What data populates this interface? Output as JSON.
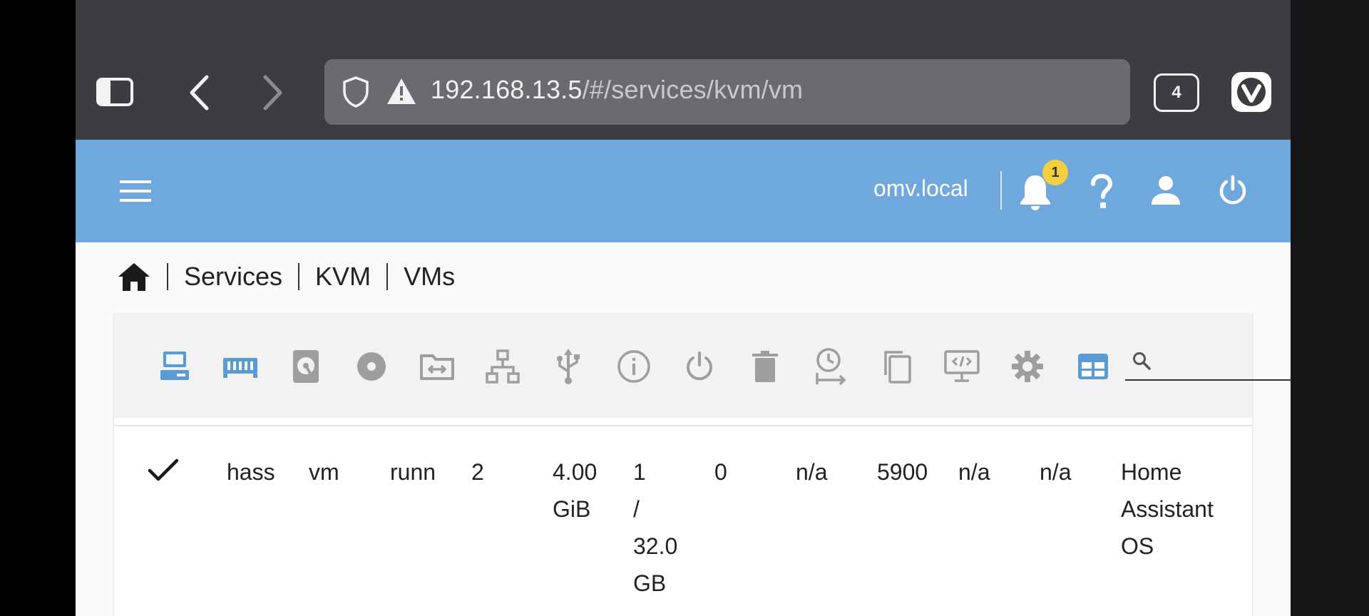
{
  "browser": {
    "url_host": "192.168.13.5",
    "url_path": "/#/services/kvm/vm",
    "tab_count": "4",
    "icons": [
      "sidebar-icon",
      "back-icon",
      "forward-icon",
      "shield-icon",
      "warning-icon",
      "vivaldi-logo"
    ]
  },
  "appbar": {
    "hostname": "omv.local",
    "notification_count": "1",
    "background": "#6fa8dc",
    "icons": [
      "menu-icon",
      "bell-icon",
      "help-icon",
      "user-icon",
      "power-icon"
    ]
  },
  "breadcrumb": {
    "items": [
      "Services",
      "KVM",
      "VMs"
    ]
  },
  "toolbar": {
    "active_color": "#6fa8dc",
    "inactive_color": "#9e9e9e",
    "tools": [
      {
        "name": "vm-icon",
        "active": true
      },
      {
        "name": "memory-icon",
        "active": true
      },
      {
        "name": "disk-icon",
        "active": false
      },
      {
        "name": "optical-disc-icon",
        "active": false
      },
      {
        "name": "shared-folder-icon",
        "active": false
      },
      {
        "name": "network-icon",
        "active": false
      },
      {
        "name": "usb-icon",
        "active": false
      },
      {
        "name": "info-icon",
        "active": false
      },
      {
        "name": "power-icon",
        "active": false
      },
      {
        "name": "delete-icon",
        "active": false
      },
      {
        "name": "schedule-icon",
        "active": false
      },
      {
        "name": "clone-icon",
        "active": false
      },
      {
        "name": "remote-desktop-icon",
        "active": false
      },
      {
        "name": "settings-icon",
        "active": false
      },
      {
        "name": "table-columns-icon",
        "active": true
      }
    ],
    "search_placeholder": ""
  },
  "table": {
    "rows": [
      {
        "selected": true,
        "cells": [
          "hass",
          "vm",
          "runn",
          "2",
          "4.00\nGiB",
          "1\n/\n32.0\nGB",
          "0",
          "n/a",
          "5900",
          "n/a",
          "n/a",
          "Home\nAssistant\nOS"
        ]
      }
    ]
  }
}
